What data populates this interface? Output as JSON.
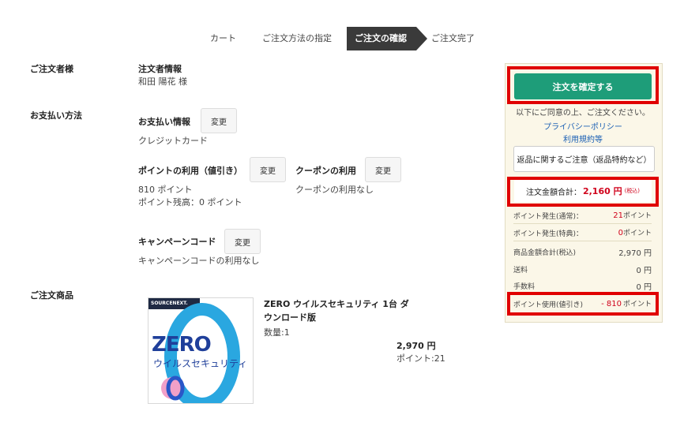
{
  "steps": [
    "カート",
    "ご注文方法の指定",
    "ご注文の確認",
    "ご注文完了"
  ],
  "orderer": {
    "section": "ご注文者様",
    "heading": "注文者情報",
    "name": "和田 陽花 様"
  },
  "payment": {
    "section": "お支払い方法",
    "info_heading": "お支払い情報",
    "info_value": "クレジットカード",
    "change": "変更",
    "points_heading": "ポイントの利用（値引き）",
    "points_used": "810 ポイント",
    "points_balance": "ポイント残高：0 ポイント",
    "coupon_heading": "クーポンの利用",
    "coupon_value": "クーポンの利用なし",
    "campaign_heading": "キャンペーンコード",
    "campaign_value": "キャンペーンコードの利用なし"
  },
  "product": {
    "section": "ご注文商品",
    "brand": "SOURCENEXT.",
    "logo_text": "ZERO",
    "logo_sub": "ウイルスセキュリティ",
    "name": "ZERO ウイルスセキュリティ 1台 ダウンロード版",
    "qty": "数量:1",
    "price": "2,970 円",
    "points": "ポイント:21"
  },
  "sidebar": {
    "confirm": "注文を確定する",
    "agree": "以下にご同意の上、ご注文ください。",
    "privacy": "プライバシーポリシー",
    "terms": "利用規約等",
    "return_notice": "返品に関するご注意（返品特約など）",
    "total_label": "注文金額合計：",
    "total_value": "2,160 円",
    "total_tax": "(税込)",
    "rows": [
      {
        "label": "ポイント発生(通常)：",
        "num": "21",
        "unit": "ポイント"
      },
      {
        "label": "ポイント発生(特典)：",
        "num": "0",
        "unit": "ポイント"
      },
      {
        "label": "商品金額合計(税込)",
        "value": "2,970 円"
      },
      {
        "label": "送料",
        "value": "0 円"
      },
      {
        "label": "手数料",
        "value": "0 円"
      },
      {
        "label": "ポイント使用(値引き)",
        "num": "- 810",
        "unit": "ポイント"
      }
    ]
  },
  "colors": {
    "accent": "#1e9d79",
    "highlight": "#e00000",
    "discount": "#d0021b"
  }
}
